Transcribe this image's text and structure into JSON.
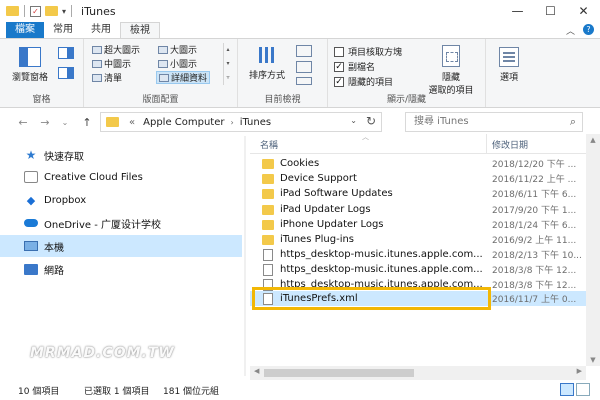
{
  "window": {
    "title": "iTunes",
    "controls": {
      "minimize": "—",
      "maximize": "☐",
      "close": "✕"
    }
  },
  "ribbon_tabs": [
    "檔案",
    "常用",
    "共用",
    "檢視"
  ],
  "ribbon": {
    "panes": {
      "preview_pane": "瀏覽窗格",
      "label": "窗格"
    },
    "layout": {
      "items": [
        "超大圖示",
        "大圖示",
        "中圖示",
        "小圖示",
        "清單",
        "詳細資料"
      ],
      "selected": "詳細資料",
      "label": "版面配置"
    },
    "current_view": {
      "sort_by": "排序方式",
      "label": "目前檢視"
    },
    "show_hide": {
      "checkboxes": [
        {
          "label": "項目核取方塊",
          "checked": false
        },
        {
          "label": "副檔名",
          "checked": true
        },
        {
          "label": "隱藏的項目",
          "checked": true
        }
      ],
      "hide_selected_line1": "隱藏",
      "hide_selected_line2": "選取的項目",
      "label": "顯示/隱藏"
    },
    "options": "選項"
  },
  "address": {
    "prefix": "«",
    "path": [
      "Apple Computer",
      "iTunes"
    ],
    "search_placeholder": "搜尋 iTunes"
  },
  "nav_pane": [
    {
      "label": "快速存取",
      "icon": "star-icon"
    },
    {
      "label": "Creative Cloud Files",
      "icon": "creative-cloud-icon"
    },
    {
      "label": "Dropbox",
      "icon": "dropbox-icon"
    },
    {
      "label": "OneDrive - 广厦设计学校",
      "icon": "onedrive-icon"
    },
    {
      "label": "本機",
      "icon": "this-pc-icon",
      "selected": true
    },
    {
      "label": "網路",
      "icon": "network-icon"
    }
  ],
  "columns": {
    "name": "名稱",
    "modified": "修改日期"
  },
  "files": [
    {
      "name": "Cookies",
      "type": "folder",
      "date": "2018/12/20 下午 ..."
    },
    {
      "name": "Device Support",
      "type": "folder",
      "date": "2016/11/22 上午 ..."
    },
    {
      "name": "iPad Software Updates",
      "type": "folder",
      "date": "2018/6/11 下午 6..."
    },
    {
      "name": "iPad Updater Logs",
      "type": "folder",
      "date": "2017/9/20 下午 1..."
    },
    {
      "name": "iPhone Updater Logs",
      "type": "folder",
      "date": "2018/1/24 下午 6..."
    },
    {
      "name": "iTunes Plug-ins",
      "type": "folder",
      "date": "2016/9/2 上午 11..."
    },
    {
      "name": "https_desktop-music.itunes.apple.com...",
      "type": "file",
      "date": "2018/2/13 下午 10..."
    },
    {
      "name": "https_desktop-music.itunes.apple.com...",
      "type": "file",
      "date": "2018/3/8 下午 12..."
    },
    {
      "name": "https_desktop-music.itunes.apple.com...",
      "type": "file",
      "date": "2018/3/8 下午 12..."
    },
    {
      "name": "iTunesPrefs.xml",
      "type": "file",
      "date": "2016/11/7 上午 0...",
      "selected": true
    }
  ],
  "status": {
    "items": "10 個項目",
    "selected": "已選取 1 個項目",
    "size": "181 個位元組"
  },
  "watermark": "MRMAD.COM.TW",
  "colors": {
    "accent": "#1979ca",
    "selection": "#cce8ff",
    "highlight_border": "#f2b705",
    "folder": "#f3c94a"
  }
}
